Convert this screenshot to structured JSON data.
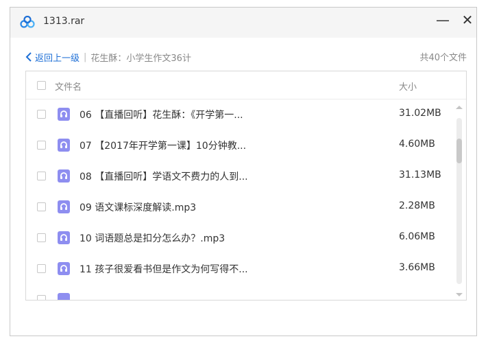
{
  "window": {
    "title": "1313.rar",
    "minimize_label": "—",
    "close_label": "✕"
  },
  "nav": {
    "back_label": "返回上一级",
    "separator": "|",
    "path": "花生酥：小学生作文36计",
    "count": "共40个文件"
  },
  "table": {
    "header_name": "文件名",
    "header_size": "大小",
    "rows": [
      {
        "name": "06 【直播回听】花生酥：《开学第一...",
        "size": "31.02MB"
      },
      {
        "name": "07 【2017年开学第一课】10分钟教...",
        "size": "4.60MB"
      },
      {
        "name": "08 【直播回听】学语文不费力的人到...",
        "size": "31.13MB"
      },
      {
        "name": "09 语文课标深度解读.mp3",
        "size": "2.28MB"
      },
      {
        "name": "10 词语题总是扣分怎么办？.mp3",
        "size": "6.06MB"
      },
      {
        "name": "11 孩子很爱看书但是作文为何写得不...",
        "size": "3.66MB"
      }
    ]
  },
  "icons": {
    "app": "cloud-link-icon",
    "file": "audio-file-icon",
    "back": "chevron-left-icon"
  },
  "colors": {
    "accent": "#1e6fd6",
    "file_icon": "#8e8ef0",
    "titlebar": "#f5f5f5"
  }
}
